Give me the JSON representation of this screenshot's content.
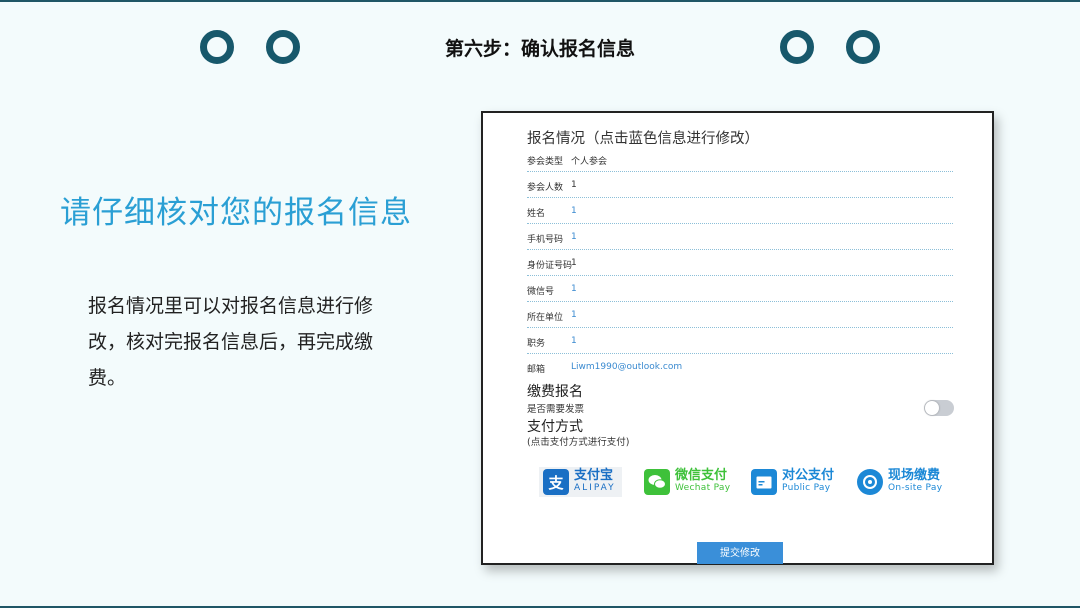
{
  "page": {
    "title": "第六步：确认报名信息",
    "headline": "请仔细核对您的报名信息",
    "description": "报名情况里可以对报名信息进行修改，核对完报名信息后，再完成缴费。",
    "colors": {
      "ring": "#17586b",
      "headline": "#2a9fd4",
      "link_blue": "#3a8ad0",
      "button": "#3a8fd9"
    }
  },
  "form": {
    "title": "报名情况（点击蓝色信息进行修改）",
    "rows": [
      {
        "label": "参会类型",
        "value": "个人参会"
      },
      {
        "label": "参会人数",
        "value": "1"
      },
      {
        "label": "姓名",
        "value": "1"
      },
      {
        "label": "手机号码",
        "value": "1"
      },
      {
        "label": "身份证号码",
        "value": "1"
      },
      {
        "label": "微信号",
        "value": "1"
      },
      {
        "label": "所在单位",
        "value": "1"
      },
      {
        "label": "职务",
        "value": "1"
      },
      {
        "label": "邮箱",
        "value": "Liwm1990@outlook.com"
      }
    ],
    "fee_title": "缴费报名",
    "invoice_label": "是否需要发票",
    "invoice_toggle": "off",
    "payment_title": "支付方式",
    "payment_hint": "(点击支付方式进行支付)",
    "payments": [
      {
        "icon": "alipay-icon",
        "cn": "支付宝",
        "en": "ALIPAY",
        "color": "#1a6fc4"
      },
      {
        "icon": "wechat-icon",
        "cn": "微信支付",
        "en": "Wechat Pay",
        "color": "#3ec13a"
      },
      {
        "icon": "card-icon",
        "cn": "对公支付",
        "en": "Public Pay",
        "color": "#1c88d6"
      },
      {
        "icon": "onsite-icon",
        "cn": "现场缴费",
        "en": "On-site Pay",
        "color": "#1c88d6"
      }
    ],
    "submit_label": "提交修改"
  }
}
